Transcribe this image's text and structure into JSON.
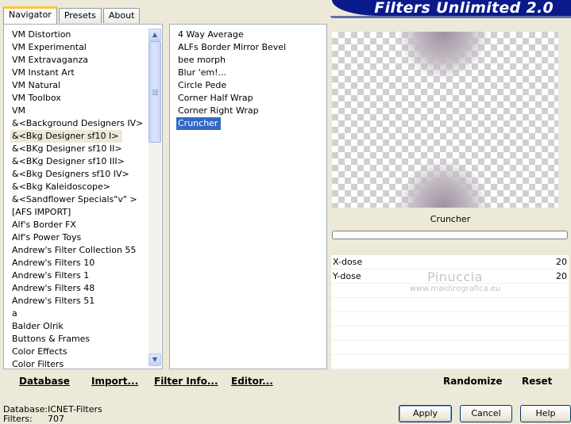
{
  "tabs": [
    {
      "label": "Navigator",
      "active": true
    },
    {
      "label": "Presets",
      "active": false
    },
    {
      "label": "About",
      "active": false
    }
  ],
  "brand": "Filters Unlimited 2.0",
  "categories": [
    "VM Distortion",
    "VM Experimental",
    "VM Extravaganza",
    "VM Instant Art",
    "VM Natural",
    "VM Toolbox",
    "VM",
    "&<Background Designers IV>",
    "&<Bkg Designer sf10 I>",
    "&<BKg Designer sf10 II>",
    "&<BKg Designer sf10 III>",
    "&<Bkg Designers sf10 IV>",
    "&<Bkg Kaleidoscope>",
    "&<Sandflower Specials\"v\" >",
    "[AFS IMPORT]",
    "Alf's Border FX",
    "Alf's Power Toys",
    "Andrew's Filter Collection 55",
    "Andrew's Filters 10",
    "Andrew's Filters 1",
    "Andrew's Filters 48",
    "Andrew's Filters 51",
    "a",
    "Balder Olrik",
    "Buttons & Frames",
    "Color Effects",
    "Color Filters"
  ],
  "selected_category_index": 8,
  "filters": [
    "4 Way Average",
    "ALFs Border Mirror Bevel",
    "bee morph",
    "Blur 'em!...",
    "Circle Pede",
    "Corner Half Wrap",
    "Corner Right Wrap",
    "Cruncher"
  ],
  "selected_filter_index": 7,
  "preview": {
    "filter_name": "Cruncher",
    "progress": 0
  },
  "params": [
    {
      "label": "X-dose",
      "value": "20"
    },
    {
      "label": "Y-dose",
      "value": "20"
    }
  ],
  "watermark": {
    "line1": "Pinuccia",
    "line2": "www.maidiregrafica.eu"
  },
  "bottom_links": {
    "database": "Database",
    "import": "Import...",
    "filter_info": "Filter Info...",
    "editor": "Editor...",
    "randomize": "Randomize",
    "reset": "Reset"
  },
  "status": {
    "database_label": "Database:",
    "database_value": "ICNET-Filters",
    "filters_label": "Filters:",
    "filters_value": "707"
  },
  "buttons": {
    "apply": "Apply",
    "cancel": "Cancel",
    "help": "Help"
  }
}
